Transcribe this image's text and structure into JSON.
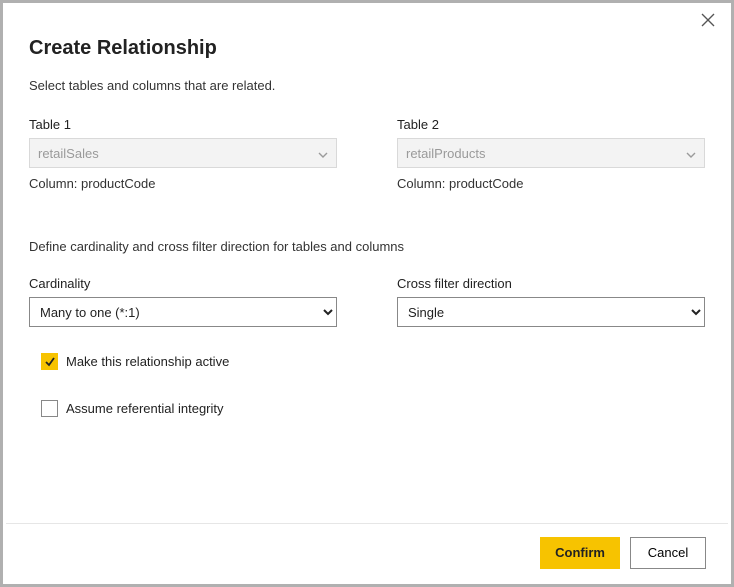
{
  "title": "Create Relationship",
  "subtitle": "Select tables and columns that are related.",
  "table1": {
    "label": "Table 1",
    "value": "retailSales",
    "column_label": "Column: productCode"
  },
  "table2": {
    "label": "Table 2",
    "value": "retailProducts",
    "column_label": "Column: productCode"
  },
  "section_text": "Define cardinality and cross filter direction for tables and columns",
  "cardinality": {
    "label": "Cardinality",
    "value": "Many to one (*:1)"
  },
  "cross_filter": {
    "label": "Cross filter direction",
    "value": "Single"
  },
  "checkbox_active": "Make this relationship active",
  "checkbox_integrity": "Assume referential integrity",
  "buttons": {
    "confirm": "Confirm",
    "cancel": "Cancel"
  }
}
